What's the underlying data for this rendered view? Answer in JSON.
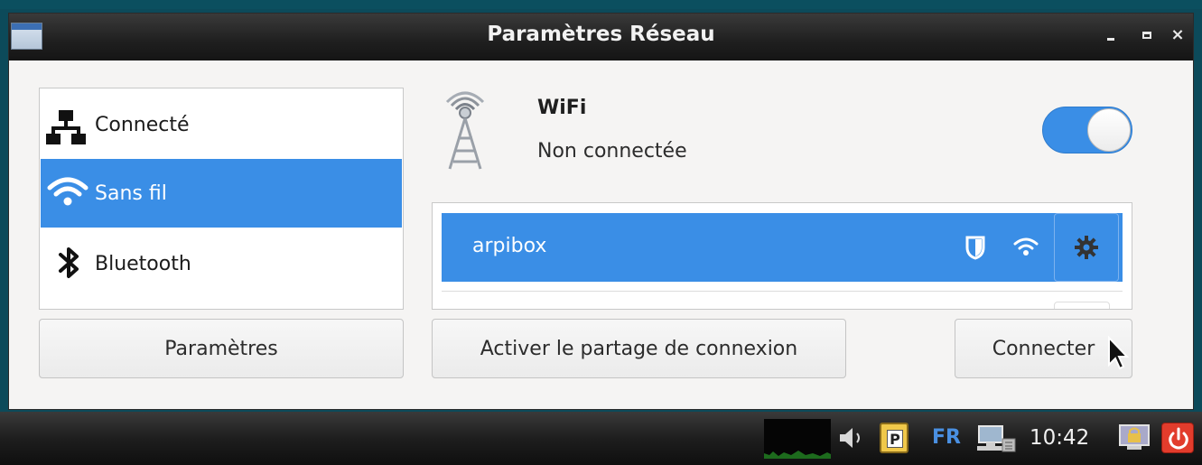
{
  "window": {
    "title": "Paramètres Réseau",
    "controls": {
      "minimize": "minimize",
      "maximize": "maximize",
      "close": "×"
    }
  },
  "nav": {
    "items": [
      {
        "label": "Connecté",
        "icon": "wired-network-icon",
        "selected": false
      },
      {
        "label": "Sans fil",
        "icon": "wifi-icon",
        "selected": true
      },
      {
        "label": "Bluetooth",
        "icon": "bluetooth-icon",
        "selected": false
      }
    ]
  },
  "wifi": {
    "title": "WiFi",
    "status": "Non connectée",
    "enabled": true
  },
  "networks": [
    {
      "ssid": "arpibox",
      "secured": true,
      "selected": true
    }
  ],
  "buttons": {
    "params": "Paramètres",
    "share": "Activer le partage de connexion",
    "connect": "Connecter"
  },
  "taskbar": {
    "clipboard_letter": "P",
    "language": "FR",
    "clock": "10:42"
  },
  "colors": {
    "accent": "#3a8ee6",
    "titlebar": "#1f1f1f",
    "window_bg": "#f5f4f3",
    "power": "#e23c2c"
  }
}
